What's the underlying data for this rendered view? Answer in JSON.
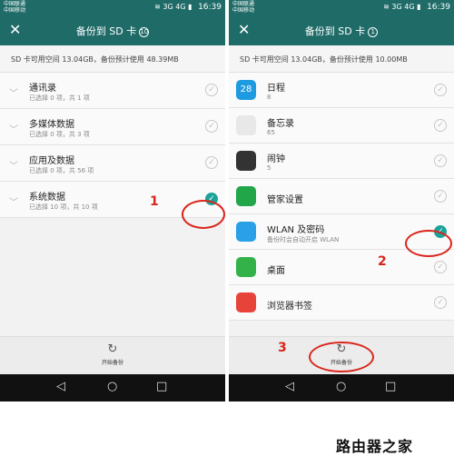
{
  "left": {
    "status": {
      "carrier1": "中国联通",
      "carrier2": "中国移动",
      "net": "3G",
      "net2": "4G",
      "time": "16:39"
    },
    "title": "备份到 SD 卡",
    "badge": "10",
    "space_info": "SD 卡可用空间 13.04GB，备份预计使用 48.39MB",
    "rows": [
      {
        "title": "通讯录",
        "sub": "已选择 0 项，共 1 项",
        "checked": false
      },
      {
        "title": "多媒体数据",
        "sub": "已选择 0 项，共 3 项",
        "checked": false
      },
      {
        "title": "应用及数据",
        "sub": "已选择 0 项，共 56 项",
        "checked": false
      },
      {
        "title": "系统数据",
        "sub": "已选择 10 项，共 10 项",
        "checked": true
      }
    ],
    "start_label": "开始备份"
  },
  "right": {
    "status": {
      "carrier1": "中国联通",
      "carrier2": "中国移动",
      "net": "3G",
      "net2": "4G",
      "time": "16:39"
    },
    "title": "备份到 SD 卡",
    "badge": "1",
    "space_info": "SD 卡可用空间 13.04GB，备份预计使用 10.00MB",
    "rows": [
      {
        "title": "日程",
        "sub": "8",
        "icon_text": "28",
        "color": "#1e9be0",
        "checked": false
      },
      {
        "title": "备忘录",
        "sub": "65",
        "icon_text": "",
        "color": "#e8e8e8",
        "checked": false
      },
      {
        "title": "闹钟",
        "sub": "5",
        "icon_text": "",
        "color": "#333333",
        "checked": false
      },
      {
        "title": "管家设置",
        "sub": "",
        "icon_text": "",
        "color": "#22a64a",
        "checked": false
      },
      {
        "title": "WLAN 及密码",
        "sub": "备份时会自动开启 WLAN",
        "icon_text": "",
        "color": "#2aa0e8",
        "checked": true
      },
      {
        "title": "桌面",
        "sub": "",
        "icon_text": "",
        "color": "#33b24a",
        "checked": false
      },
      {
        "title": "浏览器书签",
        "sub": "",
        "icon_text": "",
        "color": "#e8433a",
        "checked": false
      }
    ],
    "start_label": "开始备份"
  },
  "annotations": {
    "a1": "1",
    "a2": "2",
    "a3": "3"
  },
  "watermark": "路由器之家"
}
